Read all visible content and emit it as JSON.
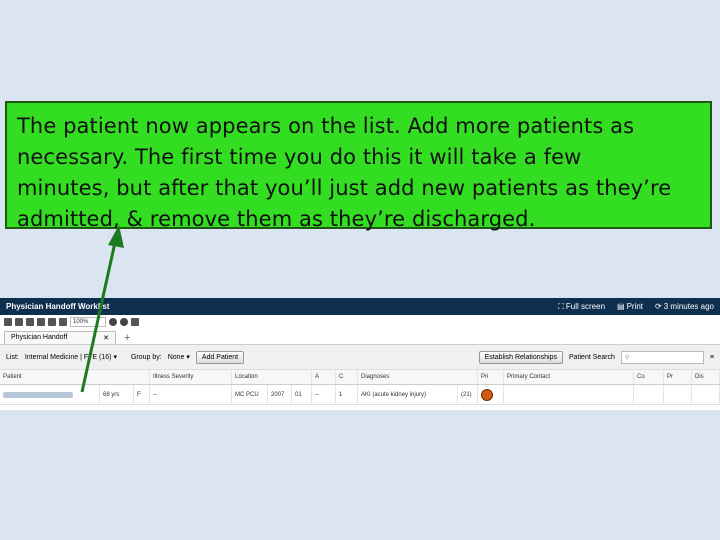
{
  "callout": {
    "line1": "The patient now appears on the list.  Add more patients as",
    "line2": "necessary.  The first time you do this it will take a few",
    "line3": "minutes, but after that you’ll just add new patients as they’re",
    "line4": "admitted, & remove them as they’re discharged."
  },
  "app": {
    "title": "Physician Handoff Worklist",
    "full_screen": "Full screen",
    "print": "Print",
    "updated": "3 minutes ago",
    "zoom": "100%",
    "tab_label": "Physician Handoff",
    "list_label": "List:",
    "list_value": "Internal Medicine | FTE (16)",
    "group_label": "Group by:",
    "group_value": "None",
    "add_patient": "Add Patient",
    "establish": "Establish Relationships",
    "search_label": "Patient Search",
    "columns": [
      "Patient",
      "Illness Severity",
      "Location",
      "A",
      "C",
      "Diagnoses",
      "Pri",
      "Primary Contact",
      "Co",
      "Pr",
      "Dis"
    ],
    "row": {
      "age": "68 yrs",
      "sex": "F",
      "severity": "--",
      "loc1": "MC PCU",
      "loc2": "2007",
      "loc3": "01",
      "a": "--",
      "c": "1",
      "diagnosis": "AKI (acute kidney injury)",
      "dx_count": "(21)"
    }
  },
  "colors": {
    "callout_bg": "#33dd22",
    "titlebar": "#0e2f4e",
    "arrow": "#1e7a1e"
  }
}
